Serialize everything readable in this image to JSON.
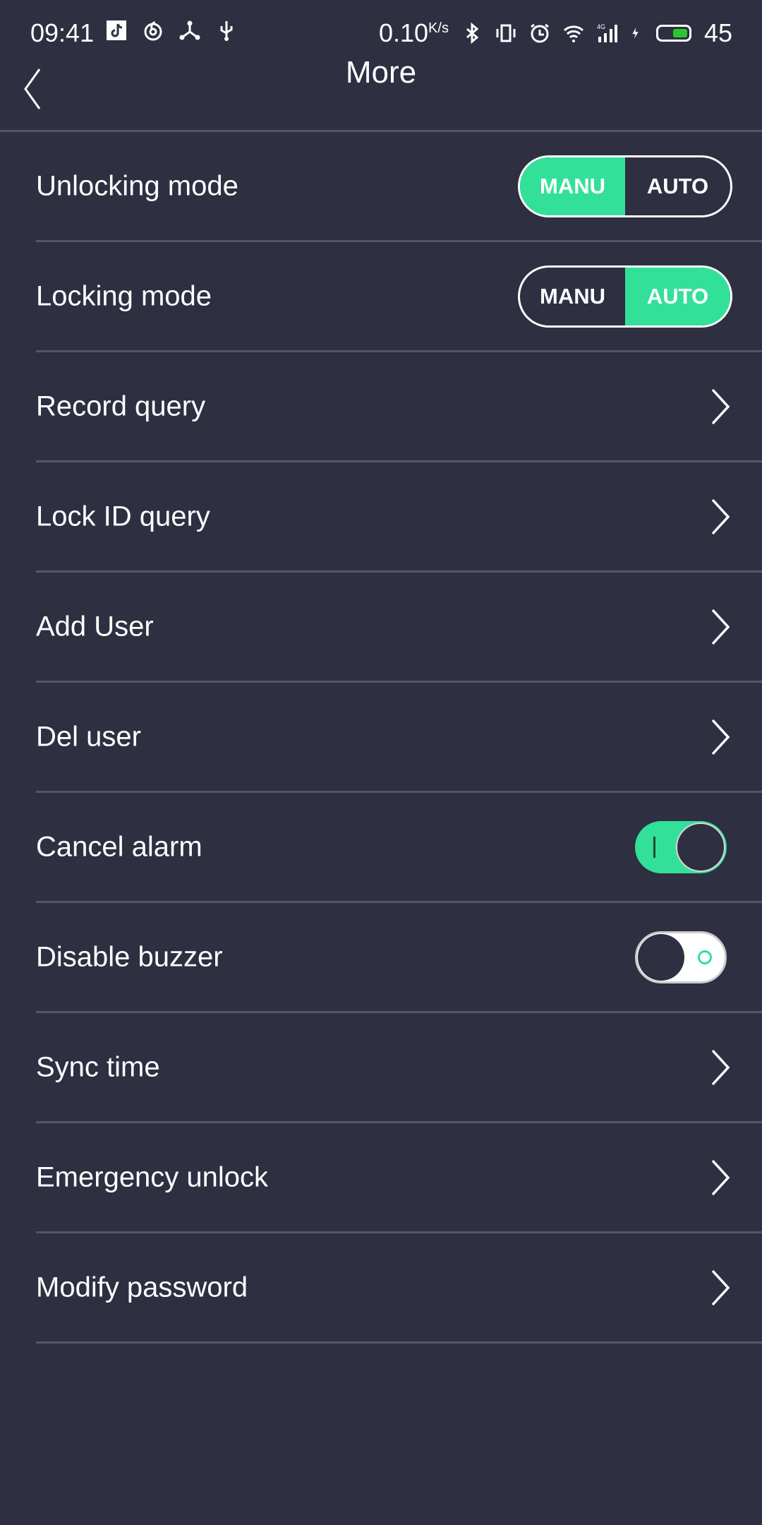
{
  "status_bar": {
    "time": "09:41",
    "left_icons": [
      "tiktok-icon",
      "netease-music-icon",
      "hotspot-share-icon",
      "usb-icon"
    ],
    "net_speed": "0.10",
    "net_unit": "K/s",
    "right_icons": [
      "bluetooth-icon",
      "vibrate-icon",
      "alarm-icon",
      "wifi-icon",
      "signal-4g-icon",
      "charging-icon"
    ],
    "battery_percent": "45",
    "battery_color": "#2ac82a"
  },
  "header": {
    "title": "More",
    "back_icon": "chevron-left-icon"
  },
  "accent_color": "#33e09a",
  "items": [
    {
      "label": "Unlocking mode",
      "control": "segmented",
      "options": [
        "MANU",
        "AUTO"
      ],
      "selected": "MANU"
    },
    {
      "label": "Locking mode",
      "control": "segmented",
      "options": [
        "MANU",
        "AUTO"
      ],
      "selected": "AUTO"
    },
    {
      "label": "Record query",
      "control": "chevron"
    },
    {
      "label": "Lock ID query",
      "control": "chevron"
    },
    {
      "label": "Add User",
      "control": "chevron"
    },
    {
      "label": "Del user",
      "control": "chevron"
    },
    {
      "label": "Cancel alarm",
      "control": "toggle",
      "state": "on"
    },
    {
      "label": "Disable buzzer",
      "control": "toggle",
      "state": "off"
    },
    {
      "label": "Sync time",
      "control": "chevron"
    },
    {
      "label": "Emergency unlock",
      "control": "chevron"
    },
    {
      "label": "Modify password",
      "control": "chevron"
    }
  ]
}
